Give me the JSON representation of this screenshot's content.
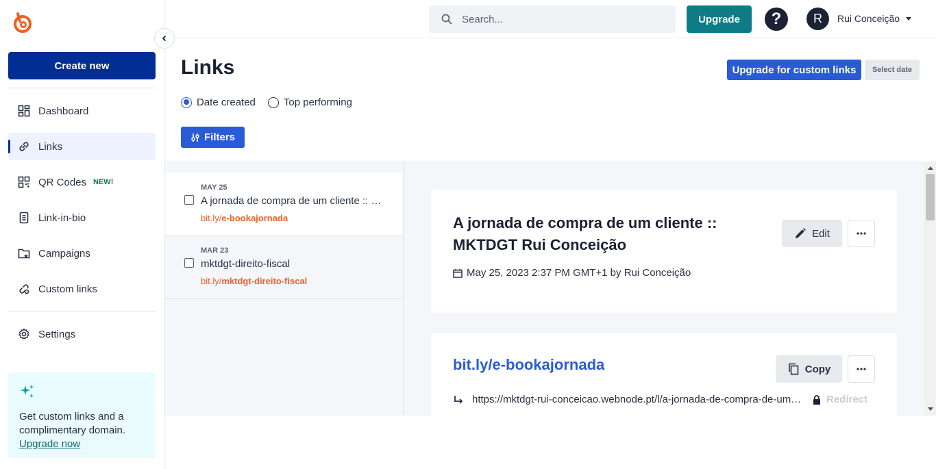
{
  "sidebar": {
    "create_label": "Create new",
    "items": [
      {
        "label": "Dashboard"
      },
      {
        "label": "Links"
      },
      {
        "label": "QR Codes",
        "badge": "NEW!"
      },
      {
        "label": "Link-in-bio"
      },
      {
        "label": "Campaigns"
      },
      {
        "label": "Custom links"
      },
      {
        "label": "Settings"
      }
    ],
    "promo": {
      "text": "Get custom links and a complimentary domain.",
      "link": "Upgrade now"
    }
  },
  "header": {
    "search_placeholder": "Search...",
    "upgrade_label": "Upgrade",
    "help_label": "?",
    "avatar_initial": "R",
    "username": "Rui Conceição"
  },
  "page": {
    "title": "Links",
    "custom_links_label": "Upgrade for custom links",
    "select_date_label": "Select date",
    "sort": {
      "date_created": "Date created",
      "top_performing": "Top performing",
      "selected": "date_created"
    },
    "filters_label": "Filters"
  },
  "list": [
    {
      "date": "MAY 25",
      "title": "A jornada de compra de um cliente :: MKTDGT Rui Conceição",
      "short_prefix": "bit.ly/",
      "short_slug": "e-bookajornada"
    },
    {
      "date": "MAR 23",
      "title": "mktdgt-direito-fiscal",
      "short_prefix": "bit.ly/",
      "short_slug": "mktdgt-direito-fiscal"
    }
  ],
  "detail": {
    "title": "A jornada de compra de um cliente :: MKTDGT Rui Conceição",
    "edit_label": "Edit",
    "meta": "May 25, 2023 2:37 PM GMT+1 by Rui Conceição",
    "short_link": "bit.ly/e-bookajornada",
    "copy_label": "Copy",
    "destination": "https://mktdgt-rui-conceicao.webnode.pt/l/a-jornada-de-compra-de-um-cliente/",
    "redirect_label": "Redirect"
  },
  "colors": {
    "brand": "#022d94",
    "accent": "#2a5bd7",
    "upgrade": "#0e7c86",
    "short_link": "#ee6123"
  }
}
